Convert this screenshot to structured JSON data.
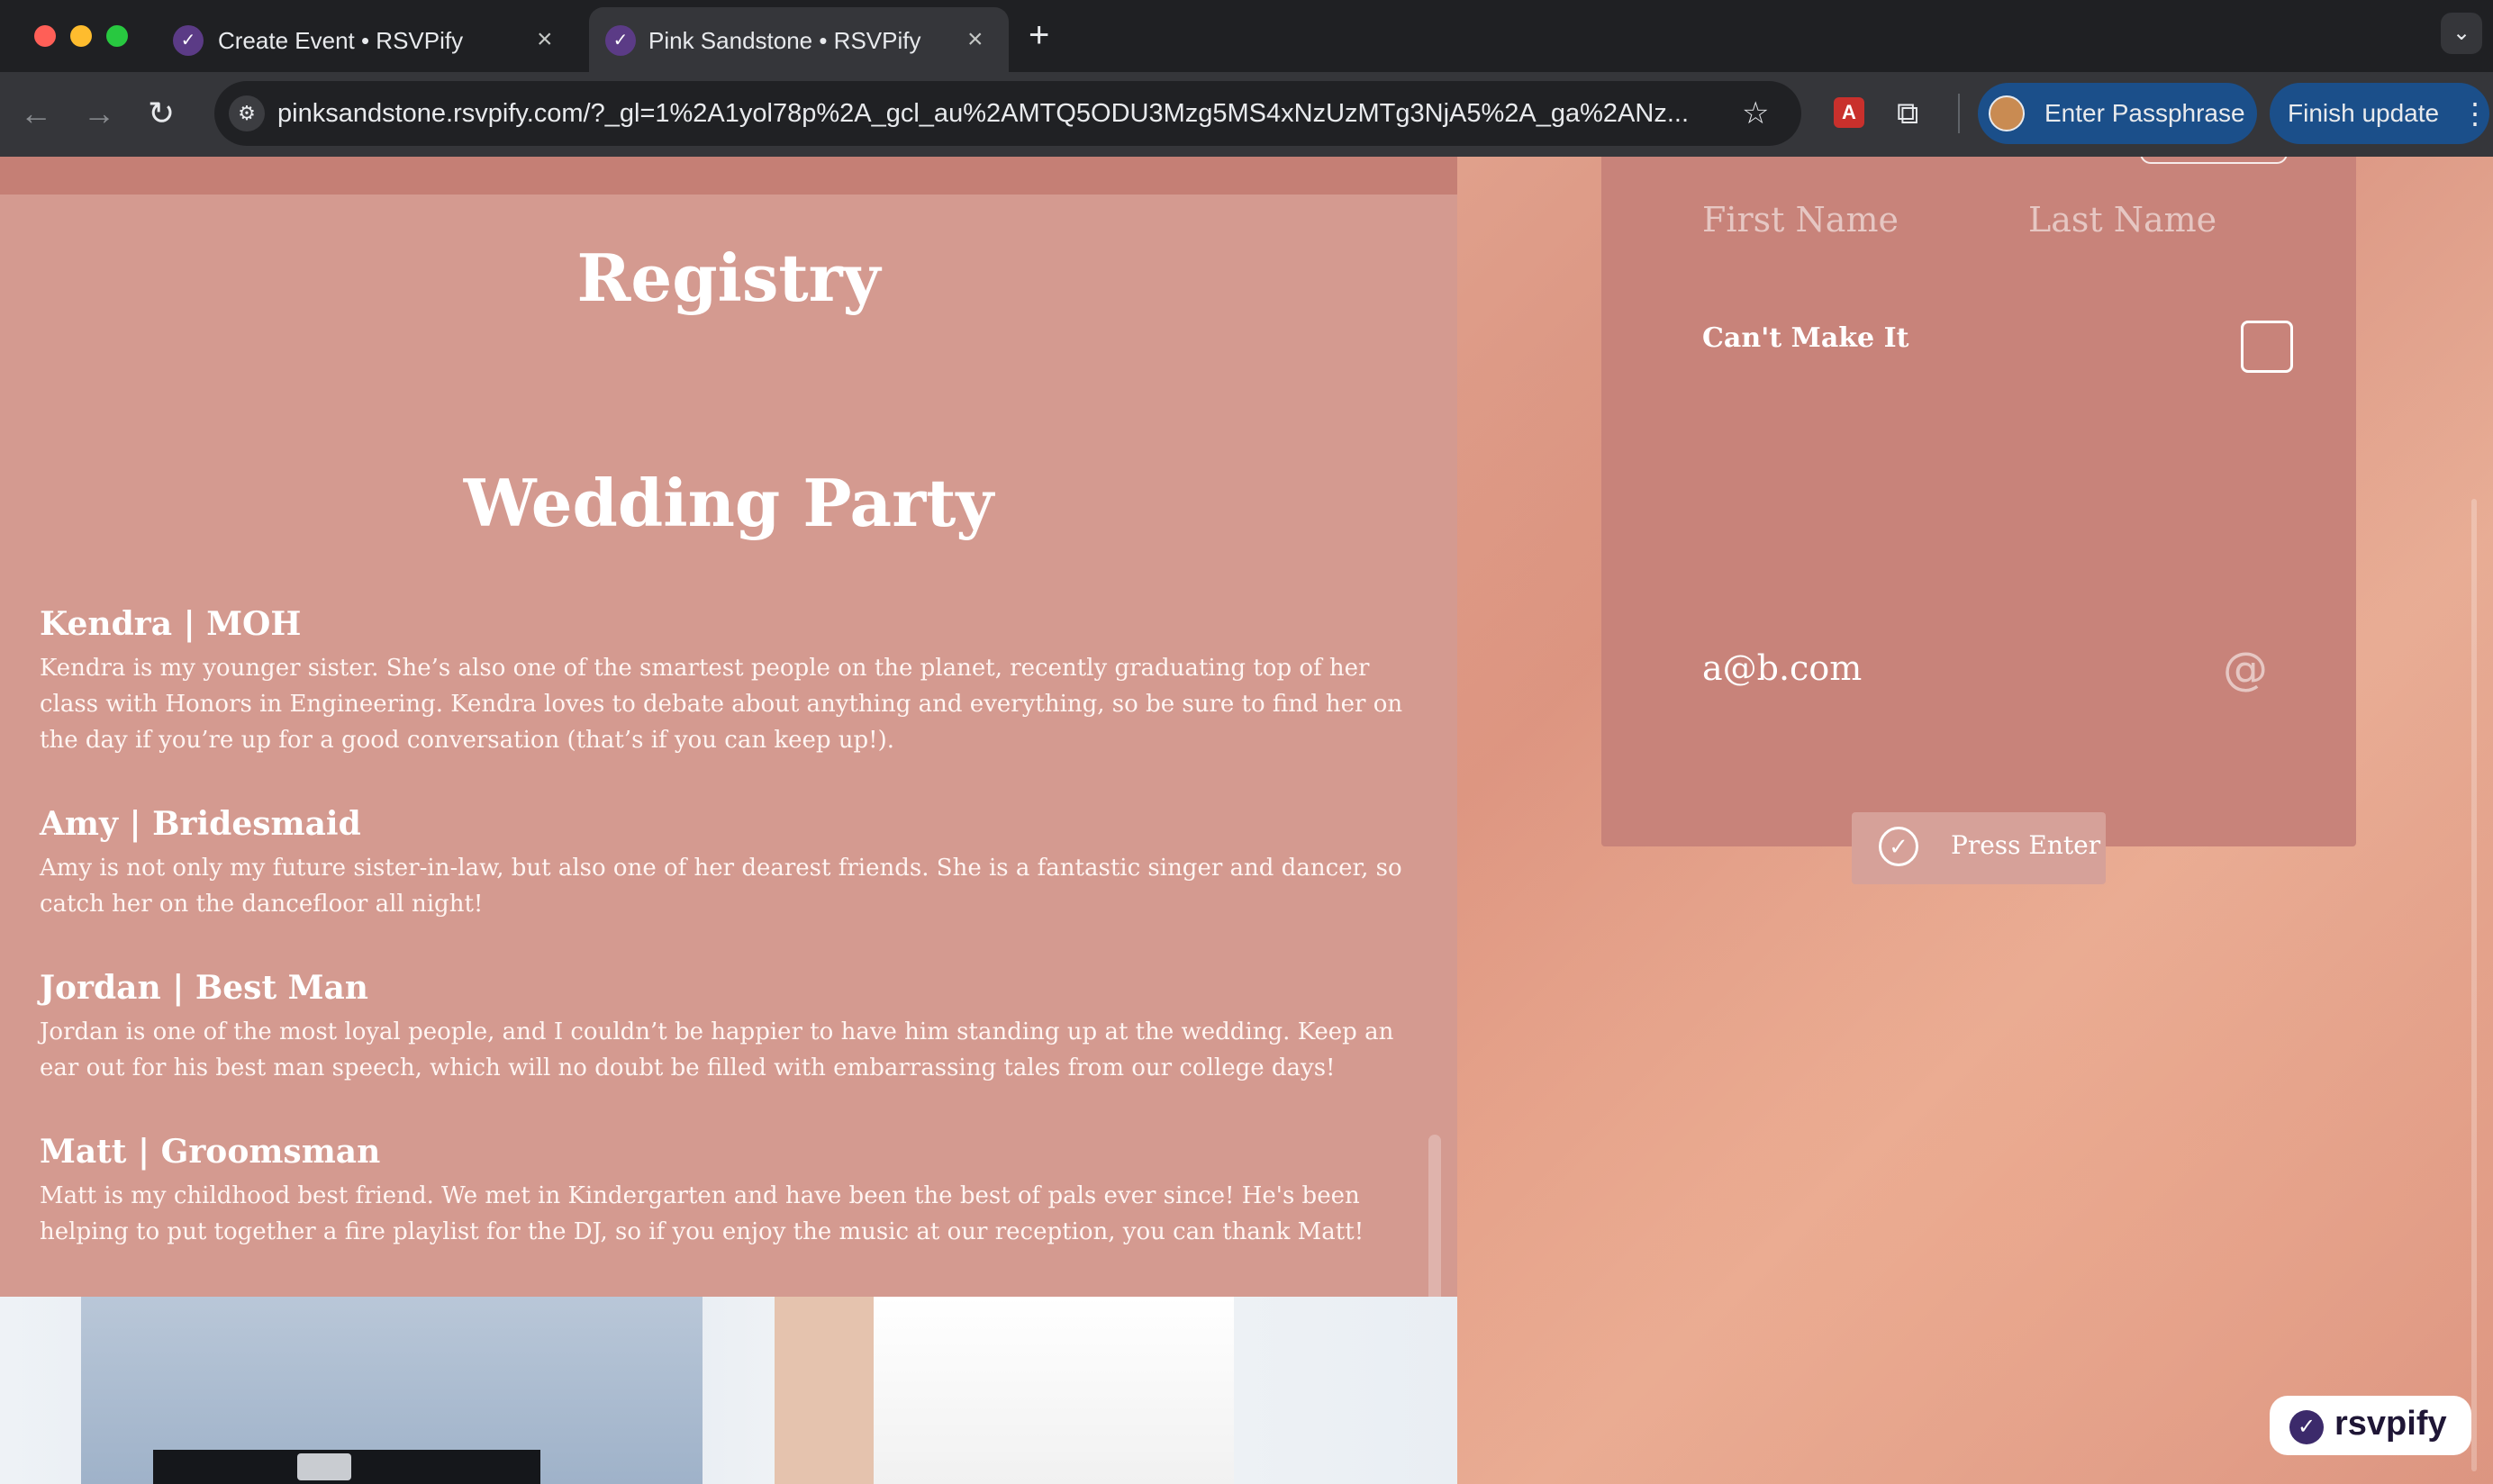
{
  "browser": {
    "tabs": [
      {
        "title": "Create Event • RSVPify",
        "active": false
      },
      {
        "title": "Pink Sandstone • RSVPify",
        "active": true
      }
    ],
    "url": "pinksandstone.rsvpify.com/?_gl=1%2A1yol78p%2A_gcl_au%2AMTQ5ODU3Mzg5MS4xNzUzMTg3NjA5%2A_ga%2ANz...",
    "profile_button": "Enter Passphrase",
    "update_button": "Finish update"
  },
  "left": {
    "registry_heading": "Registry",
    "wedding_party_heading": "Wedding Party",
    "members": [
      {
        "name": "Kendra | MOH",
        "description": "Kendra is my younger sister. She’s also one of the smartest people on the planet, recently graduating top of her class with Honors in Engineering. Kendra loves to debate about anything and everything, so be sure to find her on the day if you’re up for a good conversation (that’s if you can keep up!)."
      },
      {
        "name": "Amy | Bridesmaid",
        "description": "Amy is not only my future sister-in-law, but also one of her dearest friends. She is a fantastic singer and dancer, so catch her on the dancefloor all night!"
      },
      {
        "name": "Jordan | Best Man",
        "description": "Jordan is one of the most loyal people, and I couldn’t be happier to have him standing up at the wedding. Keep an ear out for his best man speech, which will no doubt be filled with embarrassing tales from our college days!"
      },
      {
        "name": "Matt | Groomsman",
        "description": "Matt is my childhood best friend. We met in Kindergarten and have been the best of pals ever since! He's been helping to put together a fire playlist for the DJ, so if you enjoy the music at our reception, you can thank Matt!"
      }
    ]
  },
  "rsvp": {
    "first_name_placeholder": "First Name",
    "last_name_placeholder": "Last Name",
    "cant_make_it_label": "Can't Make It",
    "email_value": "a@b.com",
    "at_icon": "@",
    "press_enter_label": "Press Enter",
    "brand": "rsvpify"
  },
  "colors": {
    "panel": "#d49a90",
    "card": "#c8837a",
    "accent_blue": "#1b4f8a"
  }
}
